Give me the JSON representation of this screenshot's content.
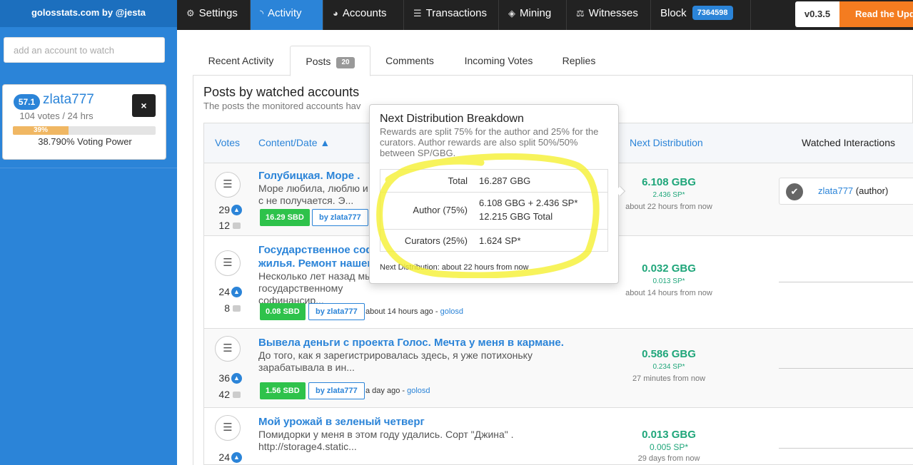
{
  "sidebar": {
    "brand": "golosstats.com by @jesta",
    "watch_placeholder": "add an account to watch",
    "account": {
      "reputation": "57.1",
      "name": "zlata777",
      "votes_text": "104 votes / 24 hrs",
      "voting_power_pct": 39,
      "voting_power_label": "39%",
      "voting_power_text": "38.790% Voting Power",
      "close_label": "×"
    }
  },
  "nav": {
    "items": [
      "Settings",
      "Activity",
      "Accounts",
      "Transactions",
      "Mining",
      "Witnesses"
    ],
    "block_label": "Block",
    "block_number": "7364598",
    "version": "v0.3.5",
    "read_update": "Read the Upd"
  },
  "tabs": {
    "items": [
      "Recent Activity",
      "Posts",
      "Comments",
      "Incoming Votes",
      "Replies"
    ],
    "posts_count": "20"
  },
  "panel": {
    "title": "Posts by watched accounts",
    "subtitle": "The posts the monitored accounts hav",
    "columns": {
      "votes": "Votes",
      "content": "Content/Date ▲",
      "next_distribution": "Next Distribution",
      "watched": "Watched Interactions"
    }
  },
  "rows": [
    {
      "votes": "29",
      "comments": "12",
      "title": "Голубицкая. Море .",
      "body": "Море любила, люблю и с не получается. Э...",
      "sbd": "16.29 SBD",
      "by": "by zlata777",
      "time": "",
      "community": "",
      "next_gbg": "6.108 GBG",
      "next_sp": "2.436 SP*",
      "next_time": "about 22 hours from now"
    },
    {
      "votes": "24",
      "comments": "8",
      "title": "Государственное соф жилья. Ремонт нашего",
      "body": "Несколько лет назад мы государственному софинансир...",
      "sbd": "0.08 SBD",
      "by": "by zlata777",
      "time": "about 14 hours ago - ",
      "community": "golosd",
      "next_gbg": "0.032 GBG",
      "next_sp": "0.013 SP*",
      "next_time": "about 14 hours from now"
    },
    {
      "votes": "36",
      "comments": "42",
      "title": "Вывела деньги с проекта Голос. Мечта у меня в кармане.",
      "body": "До того, как я зарегистрировалась здесь, я уже потихоньку зарабатывала в ин...",
      "sbd": "1.56 SBD",
      "by": "by zlata777",
      "time": "a day ago - ",
      "community": "golosd",
      "next_gbg": "0.586 GBG",
      "next_sp": "0.234 SP*",
      "next_time": "27 minutes from now"
    },
    {
      "votes": "24",
      "comments": "",
      "title": "Мой урожай в зеленый четверг",
      "body": "Помидорки у меня в этом году удались. Сорт \"Джина\" . http://storage4.static...",
      "sbd": "",
      "by": "",
      "time": "",
      "community": "",
      "next_gbg": "0.013 GBG",
      "next_sp": "0.005 SP*",
      "next_time": "29 days from now"
    }
  ],
  "watched_interaction": {
    "user": "zlata777",
    "role": " (author)"
  },
  "popover": {
    "title": "Next Distribution Breakdown",
    "description": "Rewards are split 75% for the author and 25% for the curators. Author rewards are also split 50%/50% between SP/GBG.",
    "rows": [
      {
        "label": "Total",
        "value": "16.287 GBG",
        "value2": ""
      },
      {
        "label": "Author (75%)",
        "value": "6.108 GBG + 2.436 SP*",
        "value2": "12.215 GBG Total"
      },
      {
        "label": "Curators (25%)",
        "value": "1.624 SP*",
        "value2": ""
      }
    ],
    "footer": "Next Distribution: about 22 hours from now"
  },
  "colors": {
    "brand_blue": "#2b84d8",
    "nav_dark": "#222222",
    "sbd_green": "#2ec24b",
    "gbg_teal": "#1fa67a",
    "update_orange": "#f47c20",
    "highlight_yellow": "#f5f032"
  }
}
